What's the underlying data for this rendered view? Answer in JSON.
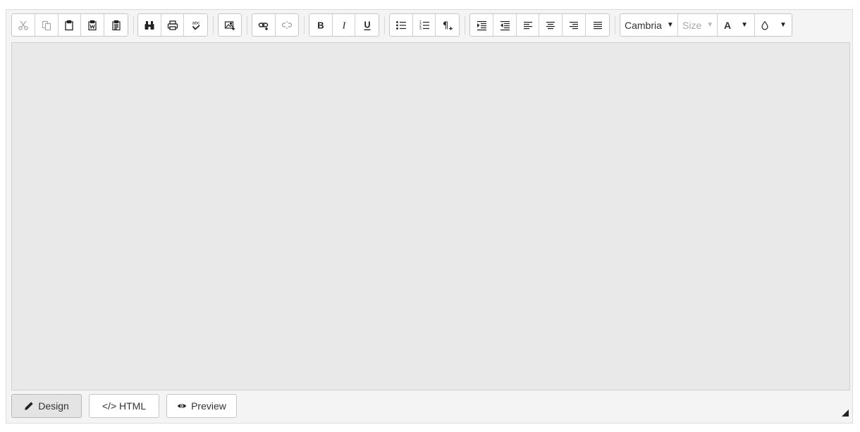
{
  "toolbar": {
    "font_family": "Cambria",
    "font_size_placeholder": "Size",
    "forecolor_label": "A"
  },
  "modes": {
    "design": "Design",
    "html": "</> HTML",
    "preview": "Preview"
  },
  "icons": {
    "cut": "scissors-icon",
    "copy": "copy-icon",
    "paste": "clipboard-icon",
    "paste_word": "paste-word-icon",
    "paste_text": "paste-text-icon",
    "find": "binoculars-icon",
    "print": "printer-icon",
    "spell": "spellcheck-icon",
    "image": "insert-image-icon",
    "link": "link-icon",
    "unlink": "unlink-icon",
    "bold": "bold-icon",
    "italic": "italic-icon",
    "underline": "underline-icon",
    "bullets": "bulleted-list-icon",
    "numbers": "numbered-list-icon",
    "paragraph": "paragraph-icon",
    "indent": "indent-icon",
    "outdent": "outdent-icon",
    "align_left": "align-left-icon",
    "align_center": "align-center-icon",
    "align_right": "align-right-icon",
    "justify": "justify-icon",
    "backcolor": "droplet-icon",
    "design": "pencil-icon",
    "preview": "eye-icon",
    "resize": "resize-grip-icon"
  },
  "colors": {
    "panel_bg": "#f4f4f4",
    "content_bg": "#e9e9e9",
    "border": "#c6c6c6",
    "disabled": "#a8a8a8",
    "active_mode_bg": "#e4e4e4"
  }
}
